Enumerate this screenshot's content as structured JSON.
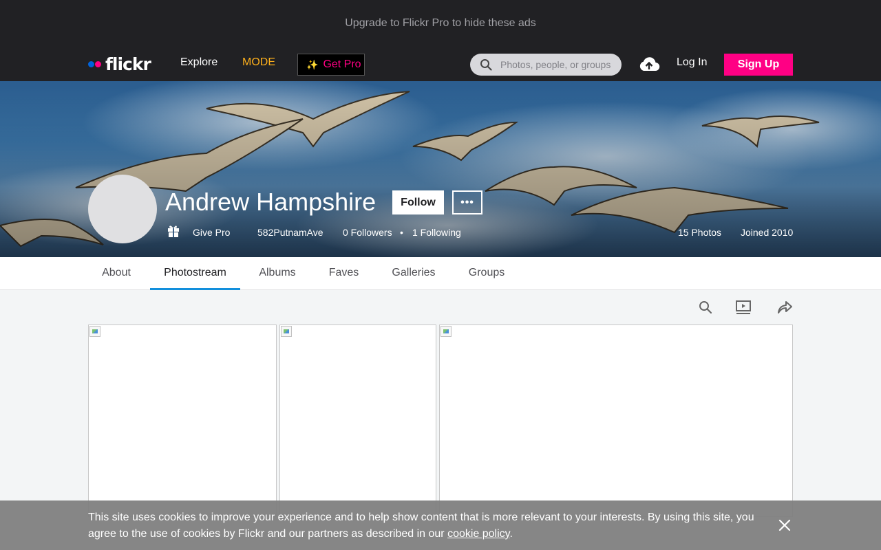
{
  "ad_bar": {
    "text": "Upgrade to Flickr Pro to hide these ads"
  },
  "nav": {
    "logo_text": "flickr",
    "explore": "Explore",
    "mode": "MODE",
    "get_pro": "Get Pro",
    "search_placeholder": "Photos, people, or groups",
    "login": "Log In",
    "signup": "Sign Up"
  },
  "profile": {
    "name": "Andrew Hampshire",
    "follow": "Follow",
    "more": "•••",
    "give_pro": "Give Pro",
    "handle": "582PutnamAve",
    "followers": "0 Followers",
    "bullet": "•",
    "following": "1 Following",
    "photos": "15 Photos",
    "joined": "Joined 2010"
  },
  "tabs": [
    {
      "label": "About"
    },
    {
      "label": "Photostream",
      "active": true
    },
    {
      "label": "Albums"
    },
    {
      "label": "Faves"
    },
    {
      "label": "Galleries"
    },
    {
      "label": "Groups"
    }
  ],
  "toolbar": {
    "icons": [
      "search-icon",
      "slideshow-icon",
      "share-icon"
    ]
  },
  "photos": [
    {
      "alt": ""
    },
    {
      "alt": ""
    },
    {
      "alt": ""
    }
  ],
  "cookie_banner": {
    "text": "This site uses cookies to improve your experience and to help show content that is more relevant to your interests. By using this site, you agree to the use of cookies by Flickr and our partners as described in our ",
    "link": "cookie policy",
    "end": "."
  },
  "colors": {
    "brand_pink": "#ff0084",
    "brand_blue": "#0063dc",
    "mode": "#ffb11b",
    "active_tab": "#128fdc"
  }
}
